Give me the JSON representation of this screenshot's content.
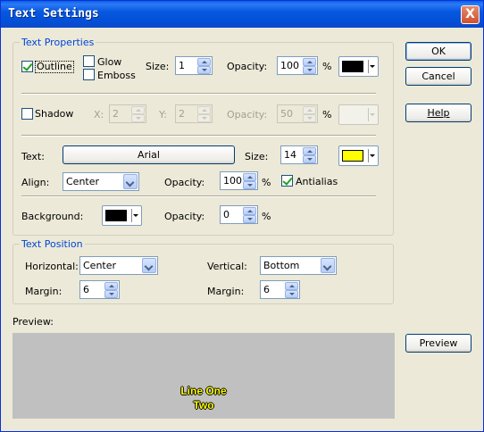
{
  "window": {
    "title": "Text Settings",
    "close_label": "X"
  },
  "text_properties": {
    "legend": "Text Properties",
    "outline": {
      "label": "Outline",
      "checked": true
    },
    "glow": {
      "label": "Glow",
      "checked": false
    },
    "emboss": {
      "label": "Emboss",
      "checked": false
    },
    "size_label": "Size:",
    "size_value": "1",
    "opacity_label": "Opacity:",
    "opacity_value": "100",
    "percent": "%",
    "outline_color": "#000000"
  },
  "shadow": {
    "label": "Shadow",
    "checked": false,
    "x_label": "X:",
    "x_value": "2",
    "y_label": "Y:",
    "y_value": "2",
    "opacity_label": "Opacity:",
    "opacity_value": "50",
    "percent": "%"
  },
  "text": {
    "text_label": "Text:",
    "font_button": "Arial",
    "size_label": "Size:",
    "size_value": "14",
    "color": "#ffff00",
    "align_label": "Align:",
    "align_value": "Center",
    "opacity_label": "Opacity:",
    "opacity_value": "100",
    "percent": "%",
    "antialias": {
      "label": "Antialias",
      "checked": true
    }
  },
  "background": {
    "label": "Background:",
    "color": "#000000",
    "opacity_label": "Opacity:",
    "opacity_value": "0",
    "percent": "%"
  },
  "text_position": {
    "legend": "Text Position",
    "horizontal_label": "Horizontal:",
    "horizontal_value": "Center",
    "vertical_label": "Vertical:",
    "vertical_value": "Bottom",
    "margin_label": "Margin:",
    "h_margin_value": "6",
    "v_margin_value": "6"
  },
  "preview": {
    "label": "Preview:",
    "line1": "Line One",
    "line2": "Two",
    "background_color": "#c0c0c0",
    "text_color": "#ffff00"
  },
  "buttons": {
    "ok": "OK",
    "cancel": "Cancel",
    "help": "Help",
    "preview": "Preview"
  }
}
